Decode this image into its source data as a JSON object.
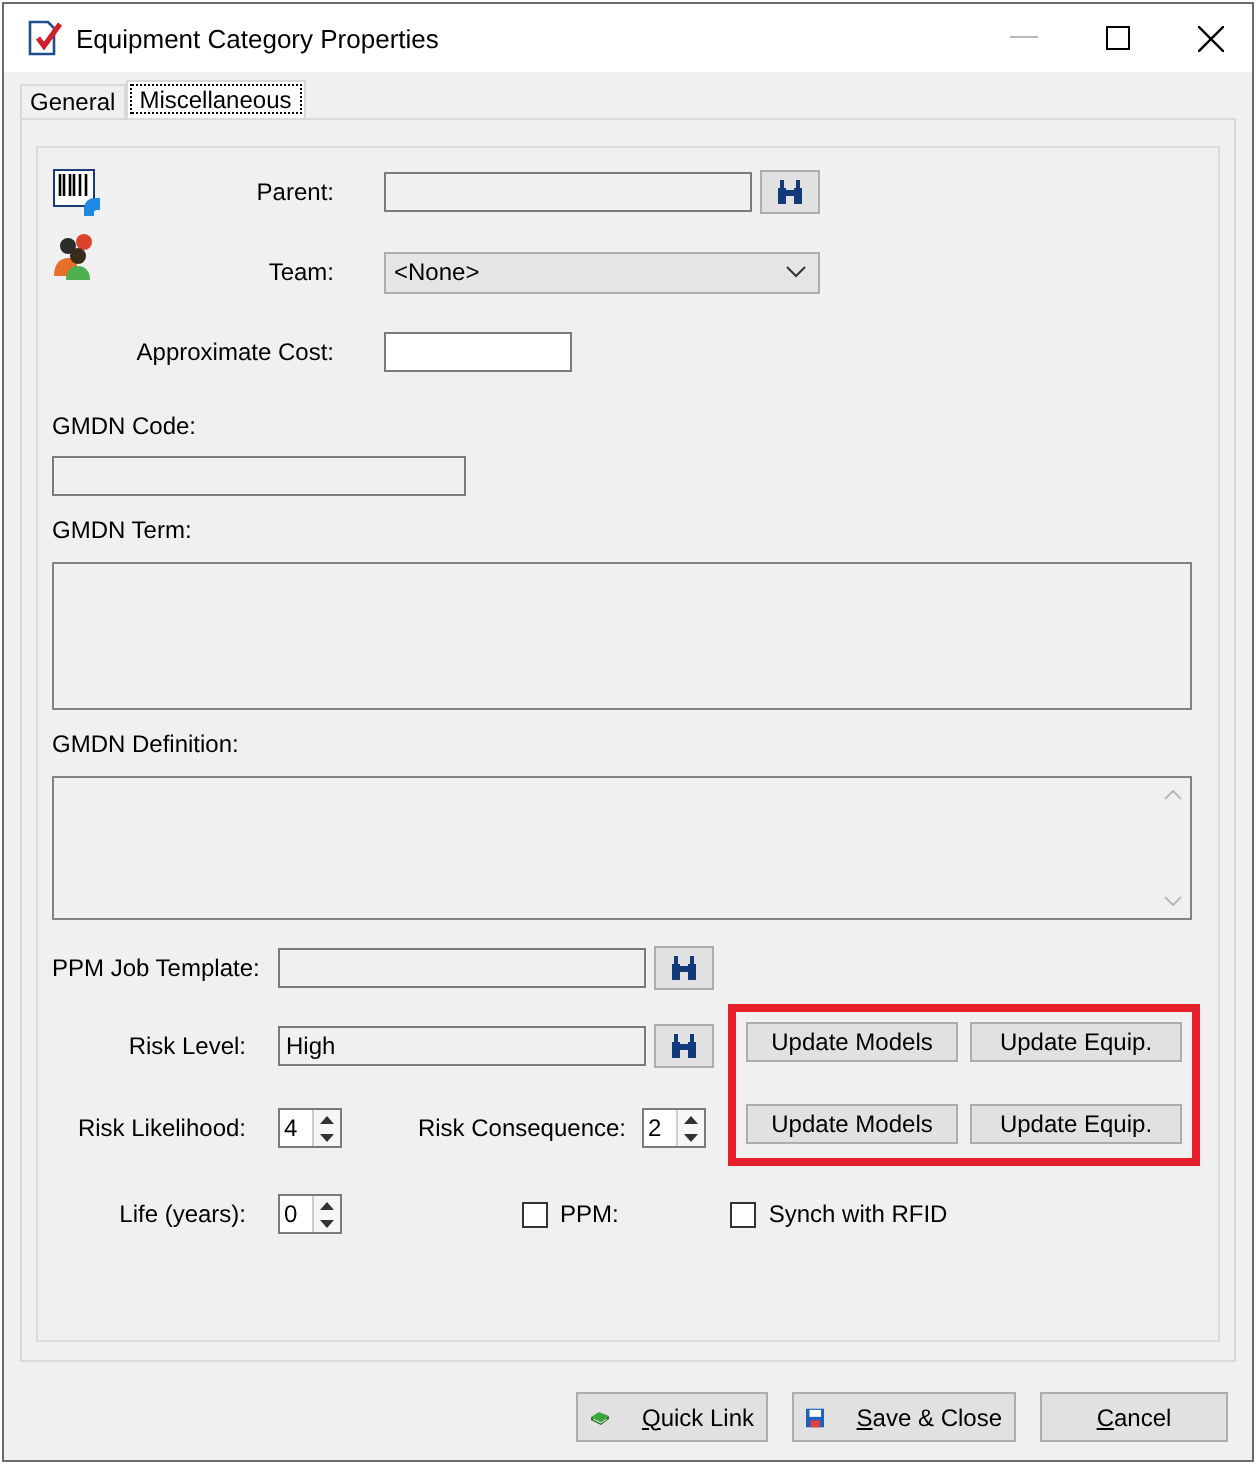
{
  "window": {
    "title": "Equipment Category Properties"
  },
  "tabs": [
    {
      "label": "General",
      "selected": false
    },
    {
      "label": "Miscellaneous",
      "selected": true
    }
  ],
  "parent": {
    "label": "Parent:"
  },
  "team": {
    "label": "Team:",
    "value": "<None>"
  },
  "approximate_cost": {
    "label": "Approximate Cost:"
  },
  "gmdn_code": {
    "label": "GMDN Code:"
  },
  "gmdn_term": {
    "label": "GMDN Term:"
  },
  "gmdn_definition": {
    "label": "GMDN Definition:"
  },
  "ppm_job_template": {
    "label": "PPM Job Template:"
  },
  "risk_level": {
    "label": "Risk Level:",
    "value": "High"
  },
  "update_buttons": [
    {
      "label": "Update Models"
    },
    {
      "label": "Update Equip."
    },
    {
      "label": "Update Models"
    },
    {
      "label": "Update Equip."
    }
  ],
  "risk_likelihood": {
    "label": "Risk Likelihood:",
    "value": "4"
  },
  "risk_consequence": {
    "label": "Risk Consequence:",
    "value": "2"
  },
  "life_years": {
    "label": "Life (years):",
    "value": "0"
  },
  "checkboxes": [
    {
      "label": "PPM:",
      "checked": false
    },
    {
      "label": "Synch with RFID",
      "checked": false
    }
  ],
  "footer_buttons": [
    {
      "kind": "quicklink",
      "key": "Q",
      "rest": "uick Link"
    },
    {
      "kind": "save",
      "key": "S",
      "rest": "ave & Close"
    },
    {
      "kind": "cancel",
      "key": "C",
      "rest": "ancel"
    }
  ]
}
